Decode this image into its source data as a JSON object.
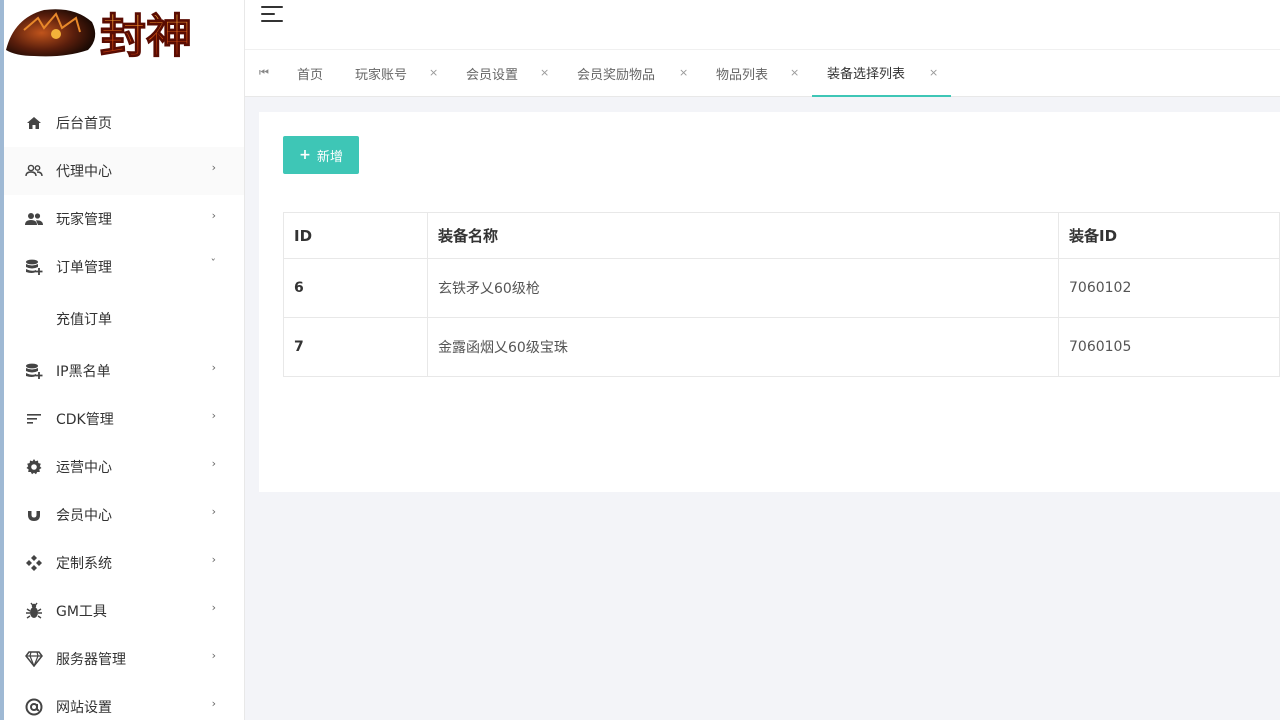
{
  "brand": {
    "logo_text": "封神"
  },
  "sidebar": {
    "items": [
      {
        "label": "后台首页",
        "icon": "home-icon",
        "has_arrow": false
      },
      {
        "label": "代理中心",
        "icon": "agents-icon",
        "has_arrow": true
      },
      {
        "label": "玩家管理",
        "icon": "players-icon",
        "has_arrow": true
      },
      {
        "label": "订单管理",
        "icon": "database-plus-icon",
        "has_arrow": true,
        "expanded": true
      },
      {
        "label": "充值订单",
        "icon": "",
        "has_arrow": false,
        "sub": true
      },
      {
        "label": "IP黑名单",
        "icon": "database-plus-icon",
        "has_arrow": true
      },
      {
        "label": "CDK管理",
        "icon": "sort-lines-icon",
        "has_arrow": true
      },
      {
        "label": "运营中心",
        "icon": "gear-icon",
        "has_arrow": true
      },
      {
        "label": "会员中心",
        "icon": "magnet-icon",
        "has_arrow": true
      },
      {
        "label": "定制系统",
        "icon": "diamond-grid-icon",
        "has_arrow": true
      },
      {
        "label": "GM工具",
        "icon": "bug-icon",
        "has_arrow": true
      },
      {
        "label": "服务器管理",
        "icon": "gem-icon",
        "has_arrow": true
      },
      {
        "label": "网站设置",
        "icon": "at-icon",
        "has_arrow": true
      }
    ]
  },
  "tabs": [
    {
      "label": "首页",
      "closable": false,
      "active": false
    },
    {
      "label": "玩家账号",
      "closable": true,
      "active": false
    },
    {
      "label": "会员设置",
      "closable": true,
      "active": false
    },
    {
      "label": "会员奖励物品",
      "closable": true,
      "active": false
    },
    {
      "label": "物品列表",
      "closable": true,
      "active": false
    },
    {
      "label": "装备选择列表",
      "closable": true,
      "active": true
    }
  ],
  "tab_close_glyph": "×",
  "toolbar": {
    "add_label": "新增",
    "add_icon": "+"
  },
  "table": {
    "columns": [
      "ID",
      "装备名称",
      "装备ID"
    ],
    "rows": [
      {
        "id": "6",
        "name": "玄铁矛乂60级枪",
        "equip_id": "7060102"
      },
      {
        "id": "7",
        "name": "金露函烟乂60级宝珠",
        "equip_id": "7060105"
      }
    ]
  },
  "colors": {
    "accent": "#3ec6b6",
    "sidebar_edge": "#9fb9d4"
  }
}
